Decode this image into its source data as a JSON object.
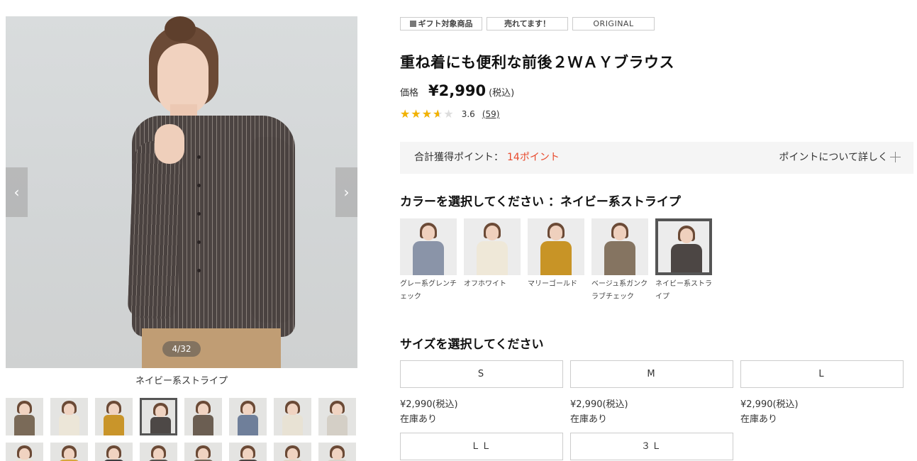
{
  "gallery": {
    "counter": "4/32",
    "caption": "ネイビー系ストライプ",
    "prev_icon": "chevron-left-icon",
    "next_icon": "chevron-right-icon",
    "thumbnails": [
      {
        "color": "#7a6a58"
      },
      {
        "color": "#ece6d8"
      },
      {
        "color": "#c9952a"
      },
      {
        "color": "#4d4846",
        "selected": true
      },
      {
        "color": "#6b5e52"
      },
      {
        "color": "#6f7f9a"
      },
      {
        "color": "#e8e2d4"
      },
      {
        "color": "#d4cfc6"
      },
      {
        "color": "#e9e3d6"
      },
      {
        "color": "#d7a63a"
      },
      {
        "color": "#3f3d40"
      },
      {
        "color": "#57524d"
      },
      {
        "color": "#76685a"
      },
      {
        "color": "#4c4442"
      },
      {
        "color": "#e0d6c8"
      },
      {
        "color": "#d9d4cb"
      }
    ]
  },
  "product": {
    "badges": [
      "ギフト対象商品",
      "売れてます！",
      "ORIGINAL"
    ],
    "title": "重ね着にも便利な前後２ＷＡＹブラウス",
    "price_label": "価格",
    "price": "¥2,990",
    "price_tax": "(税込)",
    "rating_value": 3.6,
    "rating_score": "3.6",
    "rating_count": "(59)"
  },
  "points": {
    "label": "合計獲得ポイント：",
    "value": "14ポイント",
    "more_label": "ポイントについて詳しく",
    "value_color": "#e8492c"
  },
  "color_section": {
    "heading": "カラーを選択してください ：ネイビー系ストライプ",
    "options": [
      {
        "name": "グレー系グレンチェック",
        "color": "#8a94a8"
      },
      {
        "name": "オフホワイト",
        "color": "#efe8d8"
      },
      {
        "name": "マリーゴールド",
        "color": "#c89426"
      },
      {
        "name": "ベージュ系ガンクラブチェック",
        "color": "#857461"
      },
      {
        "name": "ネイビー系ストライプ",
        "color": "#4c4644",
        "selected": true
      }
    ]
  },
  "size_section": {
    "heading": "サイズを選択してください",
    "sizes": [
      {
        "label": "S",
        "price": "¥2,990(税込)",
        "stock": "在庫あり"
      },
      {
        "label": "M",
        "price": "¥2,990(税込)",
        "stock": "在庫あり"
      },
      {
        "label": "L",
        "price": "¥2,990(税込)",
        "stock": "在庫あり"
      },
      {
        "label": "ＬＬ"
      },
      {
        "label": "３Ｌ"
      }
    ]
  }
}
